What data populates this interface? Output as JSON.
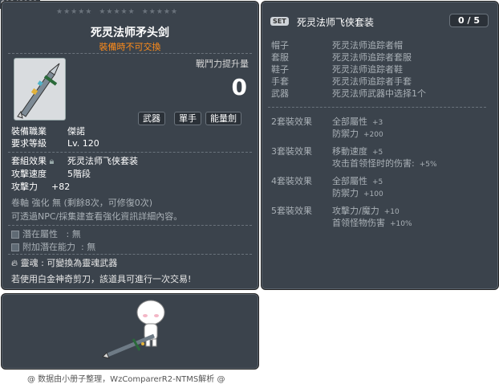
{
  "item_id": "01242131",
  "item": {
    "name": "死灵法师矛头剑",
    "trade_note": "裝備時不可交換",
    "power_label": "戰鬥力提升量",
    "power_value": "0",
    "tags": [
      "武器",
      "單手",
      "能量劍"
    ],
    "job_label": "裝備職業",
    "job_value": "傑諾",
    "level_label": "要求等級",
    "level_value": "Lv. 120",
    "set_label": "套組效果",
    "set_value": "死灵法师飞侠套装",
    "speed_label": "攻擊速度",
    "speed_value": "5階段",
    "atk_label": "攻擊力",
    "atk_value": "+82",
    "scroll_text": "卷軸 強化 無 (剩餘8次，可修復0次)",
    "npc_note": "可透過NPC/採集建查看強化資訊詳細內容。",
    "potential_label": "潛在屬性",
    "potential_value": ": 無",
    "add_potential_label": "附加潛在能力",
    "add_potential_value": ": 無",
    "soul_label": "靈魂",
    "soul_value": ": 可變換為靈魂武器",
    "scissors_note": "若使用白金神奇剪刀，該道具可進行一次交易!"
  },
  "set": {
    "badge": "SET",
    "title": "死灵法师飞侠套装",
    "count": "0 / 5",
    "pieces": [
      {
        "slot": "帽子",
        "name": "死灵法师追踪者帽"
      },
      {
        "slot": "套服",
        "name": "死灵法师追踪者套服"
      },
      {
        "slot": "鞋子",
        "name": "死灵法师追踪者鞋"
      },
      {
        "slot": "手套",
        "name": "死灵法师追踪者手套"
      },
      {
        "slot": "武器",
        "name": "死灵法师武器中选择1个"
      }
    ],
    "bonuses": [
      {
        "header": "2套裝效果",
        "lines": [
          {
            "stat": "全部屬性",
            "val": "+3"
          },
          {
            "stat": "防禦力",
            "val": "+200"
          }
        ]
      },
      {
        "header": "3套裝效果",
        "lines": [
          {
            "stat": "移動速度",
            "val": "+5"
          },
          {
            "stat": "攻击首领怪时的伤害:",
            "val": "+5%"
          }
        ]
      },
      {
        "header": "4套裝效果",
        "lines": [
          {
            "stat": "全部屬性",
            "val": "+5"
          },
          {
            "stat": "防禦力",
            "val": "+100"
          }
        ]
      },
      {
        "header": "5套裝效果",
        "lines": [
          {
            "stat": "攻擊力/魔力",
            "val": "+10"
          },
          {
            "stat": "首领怪物伤害",
            "val": "+10%"
          }
        ]
      }
    ]
  },
  "footer": "@ 数据由小册子整理，WzComparerR2-NTMS解析 @",
  "colors": {
    "panel": "#3b434c",
    "orange": "#ff8c1a",
    "blue": "#9cd3ff"
  },
  "icons": [
    "sword-icon",
    "lock-icon",
    "soul-icon",
    "character-preview"
  ]
}
